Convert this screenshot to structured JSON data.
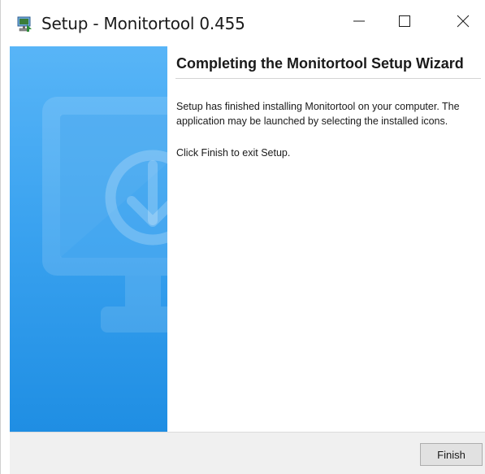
{
  "window": {
    "title": "Setup - Monitortool 0.455",
    "icon": "installer-icon",
    "controls": {
      "minimize": "minimize-icon",
      "maximize": "maximize-icon",
      "close": "close-icon"
    }
  },
  "banner": {
    "illustration": "monitor-download-icon",
    "colors": {
      "top": "#58b5f7",
      "bottom": "#1f8ee3"
    }
  },
  "content": {
    "heading": "Completing the Monitortool Setup Wizard",
    "paragraph1": "Setup has finished installing Monitortool on your computer. The application may be launched by selecting the installed icons.",
    "paragraph2": "Click Finish to exit Setup."
  },
  "footer": {
    "finish_label": "Finish"
  }
}
